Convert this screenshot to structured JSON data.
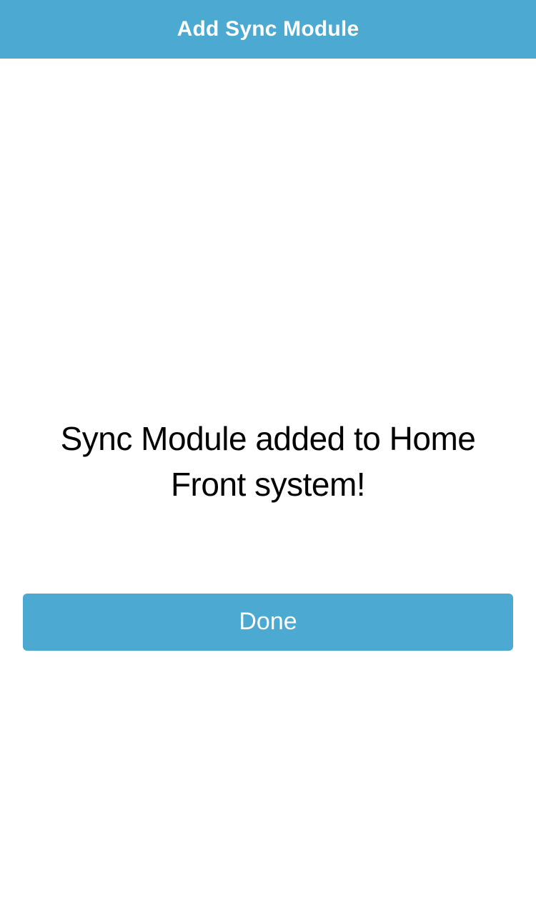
{
  "header": {
    "title": "Add Sync Module"
  },
  "main": {
    "message": "Sync Module added to Home Front system!",
    "done_label": "Done"
  },
  "colors": {
    "accent": "#4ca9d1"
  }
}
